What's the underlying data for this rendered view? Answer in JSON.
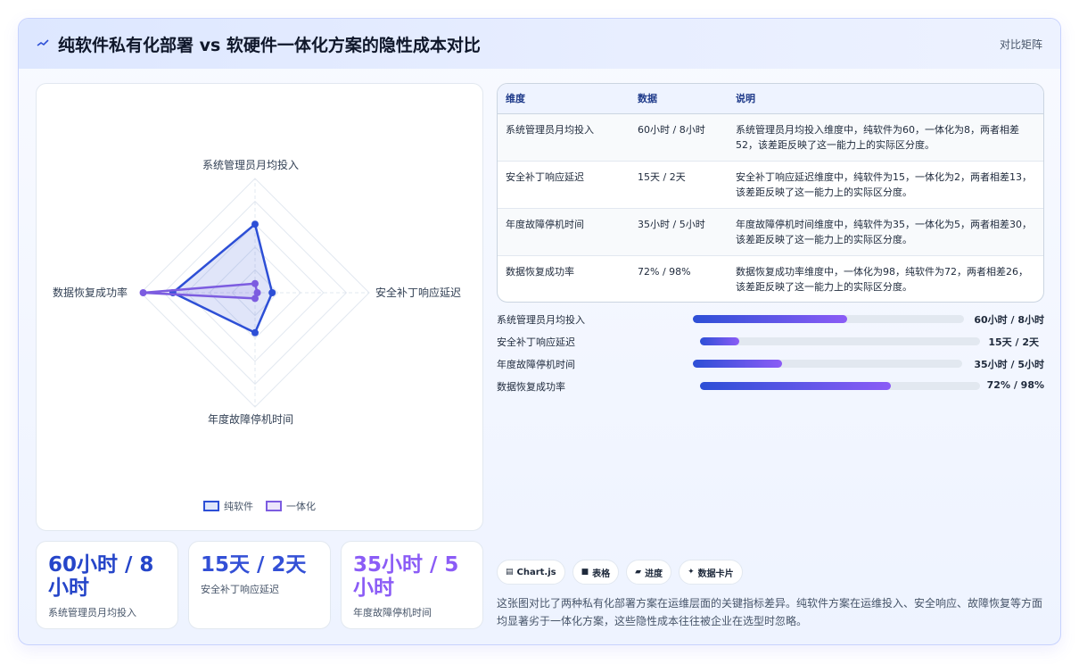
{
  "header": {
    "title": "纯软件私有化部署 vs 软硬件一体化方案的隐性成本对比",
    "tag": "对比矩阵"
  },
  "colors": {
    "series_a": "#2d4fd6",
    "series_b": "#7c5ce0",
    "stat_1": "#2545c9",
    "stat_2": "#3350d6",
    "stat_3": "#8b5cf6"
  },
  "chart_data": {
    "type": "radar",
    "axes": [
      "系统管理员月均投入",
      "安全补丁响应延迟",
      "年度故障停机时间",
      "数据恢复成功率"
    ],
    "rmax": 100,
    "rings": 5,
    "series": [
      {
        "name": "纯软件",
        "values": [
          60,
          15,
          35,
          72
        ]
      },
      {
        "name": "一体化",
        "values": [
          8,
          2,
          5,
          98
        ]
      }
    ],
    "legend_position": "bottom"
  },
  "stats": [
    {
      "value": "60小时 / 8小时",
      "label": "系统管理员月均投入"
    },
    {
      "value": "15天 / 2天",
      "label": "安全补丁响应延迟"
    },
    {
      "value": "35小时 / 5小时",
      "label": "年度故障停机时间"
    }
  ],
  "table": {
    "headers": [
      "维度",
      "数据",
      "说明"
    ],
    "rows": [
      {
        "dim": "系统管理员月均投入",
        "data": "60小时 / 8小时",
        "desc": "系统管理员月均投入维度中，纯软件为60，一体化为8，两者相差52，该差距反映了这一能力上的实际区分度。"
      },
      {
        "dim": "安全补丁响应延迟",
        "data": "15天 / 2天",
        "desc": "安全补丁响应延迟维度中，纯软件为15，一体化为2，两者相差13，该差距反映了这一能力上的实际区分度。"
      },
      {
        "dim": "年度故障停机时间",
        "data": "35小时 / 5小时",
        "desc": "年度故障停机时间维度中，纯软件为35，一体化为5，两者相差30，该差距反映了这一能力上的实际区分度。"
      },
      {
        "dim": "数据恢复成功率",
        "data": "72% / 98%",
        "desc": "数据恢复成功率维度中，一体化为98，纯软件为72，两者相差26，该差距反映了这一能力上的实际区分度。"
      }
    ]
  },
  "bars": [
    {
      "name": "系统管理员月均投入",
      "value": "60小时 / 8小时",
      "fraction": 0.57
    },
    {
      "name": "安全补丁响应延迟",
      "value": "15天 / 2天",
      "fraction": 0.14
    },
    {
      "name": "年度故障停机时间",
      "value": "35小时 / 5小时",
      "fraction": 0.33
    },
    {
      "name": "数据恢复成功率",
      "value": "72% / 98%",
      "fraction": 0.68
    }
  ],
  "chips": [
    {
      "icon": "▤",
      "label": "Chart.js"
    },
    {
      "icon": "■",
      "label": "表格"
    },
    {
      "icon": "▰",
      "label": "进度"
    },
    {
      "icon": "✦",
      "label": "数据卡片"
    }
  ],
  "summary": "这张图对比了两种私有化部署方案在运维层面的关键指标差异。纯软件方案在运维投入、安全响应、故障恢复等方面均显著劣于一体化方案，这些隐性成本往往被企业在选型时忽略。"
}
